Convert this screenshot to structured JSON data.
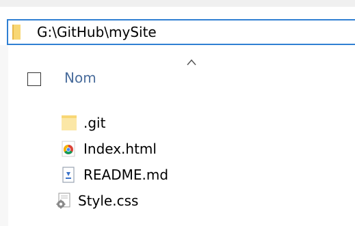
{
  "address_bar": {
    "path": "G:\\GitHub\\mySite",
    "icon": "folder-icon"
  },
  "column_header": {
    "name_label": "Nom",
    "sort_icon": "chevron-up-icon"
  },
  "files": [
    {
      "name": ".git",
      "icon": "folder-icon"
    },
    {
      "name": "Index.html",
      "icon": "chrome-html-icon"
    },
    {
      "name": "README.md",
      "icon": "markdown-file-icon"
    },
    {
      "name": "Style.css",
      "icon": "css-file-icon"
    }
  ],
  "colors": {
    "address_border": "#2f7fd3",
    "column_header_text": "#4a6d9c",
    "folder_yellow": "#f8d775"
  }
}
